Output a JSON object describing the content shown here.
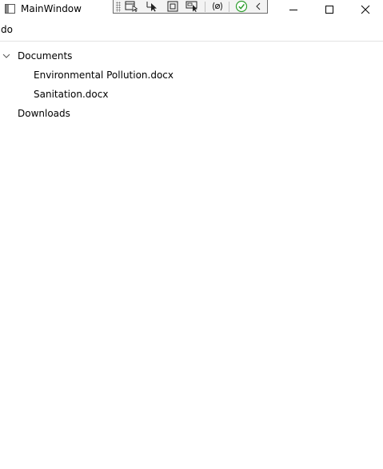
{
  "window": {
    "title": "MainWindow"
  },
  "debug_toolbar": {
    "buttons": [
      {
        "icon": "select-element-icon"
      },
      {
        "icon": "pointer-select-icon"
      },
      {
        "icon": "layout-adorner-icon"
      },
      {
        "icon": "track-focus-icon"
      },
      {
        "icon": "binding-failures-icon"
      },
      {
        "icon": "checkmark-icon"
      },
      {
        "icon": "collapse-chevron-icon"
      }
    ]
  },
  "search": {
    "value": "do"
  },
  "tree": {
    "folders": [
      {
        "label": "Documents",
        "expanded": true,
        "children": [
          {
            "label": "Environmental Pollution.docx"
          },
          {
            "label": "Sanitation.docx"
          }
        ]
      },
      {
        "label": "Downloads",
        "expanded": false,
        "children": []
      }
    ]
  },
  "colors": {
    "accent_green": "#2e9e2e",
    "toolbar_border": "#6b6b6b"
  }
}
